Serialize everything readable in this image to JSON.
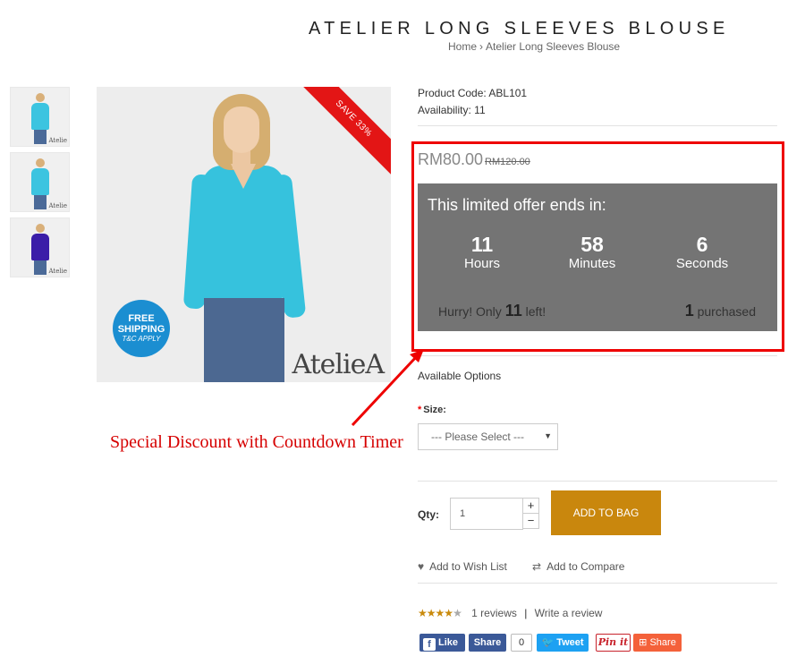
{
  "product": {
    "title": "ATELIER LONG SLEEVES BLOUSE",
    "breadcrumb": [
      "Home",
      "Atelier Long Sleeves Blouse"
    ],
    "breadcrumb_sep": "›",
    "code_label": "Product Code:",
    "code": "ABL101",
    "availability_label": "Availability:",
    "availability": "11"
  },
  "image": {
    "save_badge": "SAVE 33%",
    "free_shipping_line1": "FREE",
    "free_shipping_line2": "SHIPPING",
    "free_shipping_line3": "T&C APPLY",
    "brand": "AtelieA",
    "thumb_brand": "Atelie",
    "thumbs": [
      {
        "color": "#3cc4e0"
      },
      {
        "color": "#3cc4e0"
      },
      {
        "color": "#3b1ea8"
      }
    ]
  },
  "price": {
    "current": "RM80.00",
    "old": "RM120.00"
  },
  "countdown": {
    "heading": "This limited offer ends in:",
    "hours": "11",
    "hours_label": "Hours",
    "minutes": "58",
    "minutes_label": "Minutes",
    "seconds": "6",
    "seconds_label": "Seconds",
    "hurry_prefix": "Hurry! Only",
    "hurry_count": "11",
    "hurry_suffix": "left!",
    "purchased_count": "1",
    "purchased_label": "purchased"
  },
  "annotation": "Special Discount with Countdown Timer",
  "options": {
    "heading": "Available Options",
    "required_mark": "*",
    "size_label": "Size:",
    "size_placeholder": "--- Please Select ---"
  },
  "cart": {
    "qty_label": "Qty:",
    "qty_value": "1",
    "plus": "+",
    "minus": "−",
    "add_button": "ADD TO BAG"
  },
  "actions": {
    "wishlist": "Add to Wish List",
    "compare": "Add to Compare"
  },
  "rating": {
    "stars": 4,
    "max": 5,
    "reviews": "1 reviews",
    "separator": "|",
    "write": "Write a review"
  },
  "social": {
    "like": "Like",
    "share": "Share",
    "share_count": "0",
    "tweet": "Tweet",
    "pinit": "Pin it",
    "share2": "Share"
  },
  "colors": {
    "accent_button": "#c9870d",
    "highlight": "#e00000",
    "countdown_bg": "#747474",
    "annotation": "#d60000"
  }
}
